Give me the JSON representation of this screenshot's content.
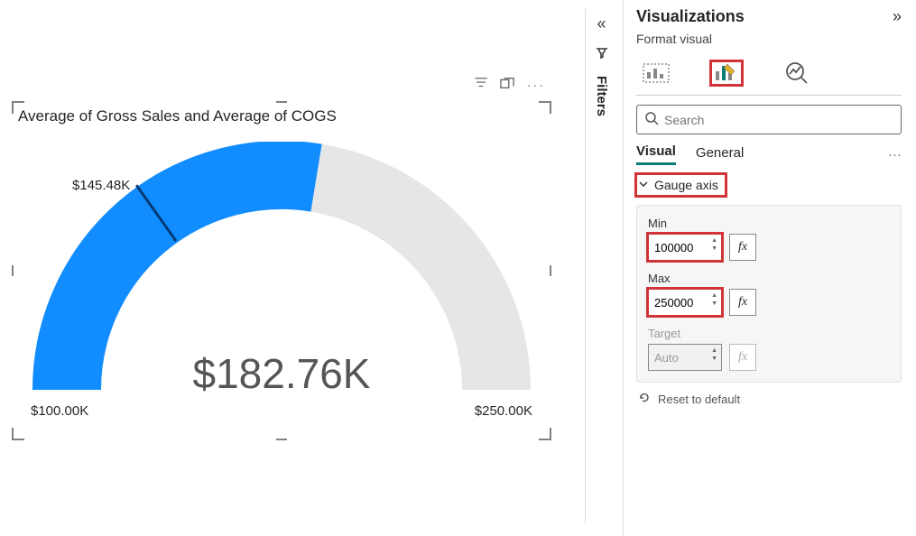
{
  "chart_data": {
    "type": "gauge",
    "title": "Average of Gross Sales and Average of COGS",
    "min": 100000,
    "max": 250000,
    "value": 182760,
    "target": 145480,
    "value_label": "$182.76K",
    "min_label": "$100.00K",
    "max_label": "$250.00K",
    "target_label": "$145.48K",
    "colors": {
      "fill": "#118dff",
      "empty": "#e6e6e6",
      "needle": "#043a75"
    }
  },
  "panels": {
    "filters": {
      "label": "Filters"
    },
    "visualizations": {
      "title": "Visualizations",
      "subtitle": "Format visual",
      "search_placeholder": "Search",
      "tabs": {
        "visual": "Visual",
        "general": "General"
      },
      "section": {
        "gauge_axis": {
          "title": "Gauge axis",
          "min_label": "Min",
          "min_value": "100000",
          "max_label": "Max",
          "max_value": "250000",
          "target_label": "Target",
          "target_value": "Auto"
        }
      },
      "reset": "Reset to default"
    }
  }
}
